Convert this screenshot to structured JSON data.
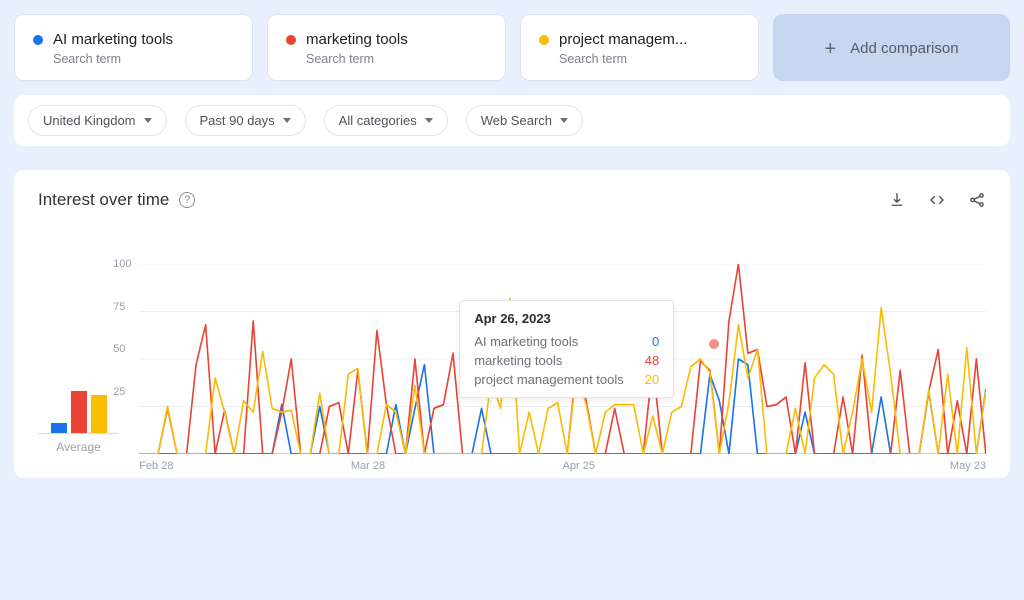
{
  "terms": [
    {
      "label": "AI marketing tools",
      "sub": "Search term",
      "color": "#1a73e8"
    },
    {
      "label": "marketing tools",
      "sub": "Search term",
      "color": "#ea4335"
    },
    {
      "label": "project managem...",
      "sub": "Search term",
      "color": "#fbbc05"
    }
  ],
  "add_label": "Add comparison",
  "filters": {
    "region": "United Kingdom",
    "range": "Past 90 days",
    "category": "All categories",
    "type": "Web Search"
  },
  "panel_title": "Interest over time",
  "avg_label": "Average",
  "tooltip": {
    "date": "Apr 26, 2023",
    "rows": [
      {
        "label": "AI marketing tools",
        "value": 0,
        "color": "#1a73e8"
      },
      {
        "label": "marketing tools",
        "value": 48,
        "color": "#ea4335"
      },
      {
        "label": "project management tools",
        "value": 20,
        "color": "#fbbc05"
      }
    ]
  },
  "avg_bars": [
    {
      "color": "#1a73e8",
      "value": 5
    },
    {
      "color": "#ea4335",
      "value": 21
    },
    {
      "color": "#fbbc05",
      "value": 19
    }
  ],
  "chart_data": {
    "type": "line",
    "title": "Interest over time",
    "ylabel": "",
    "xlabel": "",
    "ylim": [
      0,
      100
    ],
    "yticks": [
      25,
      50,
      75,
      100
    ],
    "x_tick_labels": [
      "Feb 28",
      "Mar 28",
      "Apr 25",
      "May 23"
    ],
    "x": [
      0,
      1,
      2,
      3,
      4,
      5,
      6,
      7,
      8,
      9,
      10,
      11,
      12,
      13,
      14,
      15,
      16,
      17,
      18,
      19,
      20,
      21,
      22,
      23,
      24,
      25,
      26,
      27,
      28,
      29,
      30,
      31,
      32,
      33,
      34,
      35,
      36,
      37,
      38,
      39,
      40,
      41,
      42,
      43,
      44,
      45,
      46,
      47,
      48,
      49,
      50,
      51,
      52,
      53,
      54,
      55,
      56,
      57,
      58,
      59,
      60,
      61,
      62,
      63,
      64,
      65,
      66,
      67,
      68,
      69,
      70,
      71,
      72,
      73,
      74,
      75,
      76,
      77,
      78,
      79,
      80,
      81,
      82,
      83,
      84,
      85,
      86,
      87,
      88,
      89
    ],
    "series": [
      {
        "name": "AI marketing tools",
        "color": "#1a73e8",
        "values": [
          0,
          0,
          0,
          0,
          0,
          0,
          0,
          0,
          0,
          0,
          0,
          0,
          0,
          0,
          0,
          26,
          0,
          0,
          0,
          25,
          0,
          0,
          0,
          0,
          0,
          0,
          0,
          26,
          0,
          24,
          47,
          0,
          0,
          0,
          0,
          0,
          24,
          0,
          0,
          0,
          0,
          0,
          0,
          0,
          0,
          0,
          0,
          0,
          0,
          0,
          0,
          0,
          0,
          0,
          0,
          0,
          0,
          0,
          0,
          0,
          42,
          28,
          0,
          50,
          47,
          0,
          0,
          0,
          0,
          0,
          22,
          0,
          0,
          0,
          0,
          0,
          0,
          0,
          30,
          0,
          0,
          0,
          0,
          33,
          0,
          0,
          0,
          0,
          0,
          34
        ]
      },
      {
        "name": "marketing tools",
        "color": "#ea4335",
        "values": [
          0,
          0,
          0,
          24,
          0,
          0,
          47,
          68,
          0,
          23,
          0,
          0,
          70,
          0,
          0,
          22,
          50,
          0,
          0,
          0,
          25,
          27,
          0,
          44,
          0,
          65,
          26,
          0,
          0,
          50,
          0,
          24,
          26,
          53,
          0,
          0,
          0,
          0,
          0,
          0,
          0,
          0,
          0,
          0,
          0,
          0,
          47,
          28,
          0,
          0,
          24,
          0,
          0,
          0,
          48,
          0,
          0,
          0,
          0,
          49,
          44,
          0,
          70,
          100,
          53,
          55,
          25,
          26,
          30,
          0,
          48,
          0,
          0,
          0,
          30,
          0,
          52,
          0,
          0,
          0,
          44,
          0,
          0,
          33,
          55,
          0,
          28,
          0,
          50,
          0
        ]
      },
      {
        "name": "project management tools",
        "color": "#fbbc05",
        "values": [
          0,
          0,
          0,
          25,
          0,
          0,
          0,
          0,
          40,
          22,
          0,
          28,
          22,
          54,
          24,
          22,
          23,
          0,
          0,
          32,
          0,
          0,
          42,
          45,
          0,
          0,
          26,
          22,
          0,
          36,
          0,
          0,
          0,
          0,
          0,
          0,
          0,
          39,
          24,
          82,
          0,
          22,
          0,
          24,
          27,
          0,
          44,
          26,
          0,
          22,
          26,
          26,
          26,
          0,
          20,
          0,
          22,
          25,
          46,
          50,
          43,
          0,
          27,
          68,
          40,
          55,
          0,
          0,
          0,
          24,
          0,
          40,
          47,
          42,
          0,
          22,
          50,
          22,
          77,
          42,
          0,
          0,
          0,
          34,
          0,
          42,
          0,
          56,
          0,
          33
        ]
      }
    ]
  }
}
